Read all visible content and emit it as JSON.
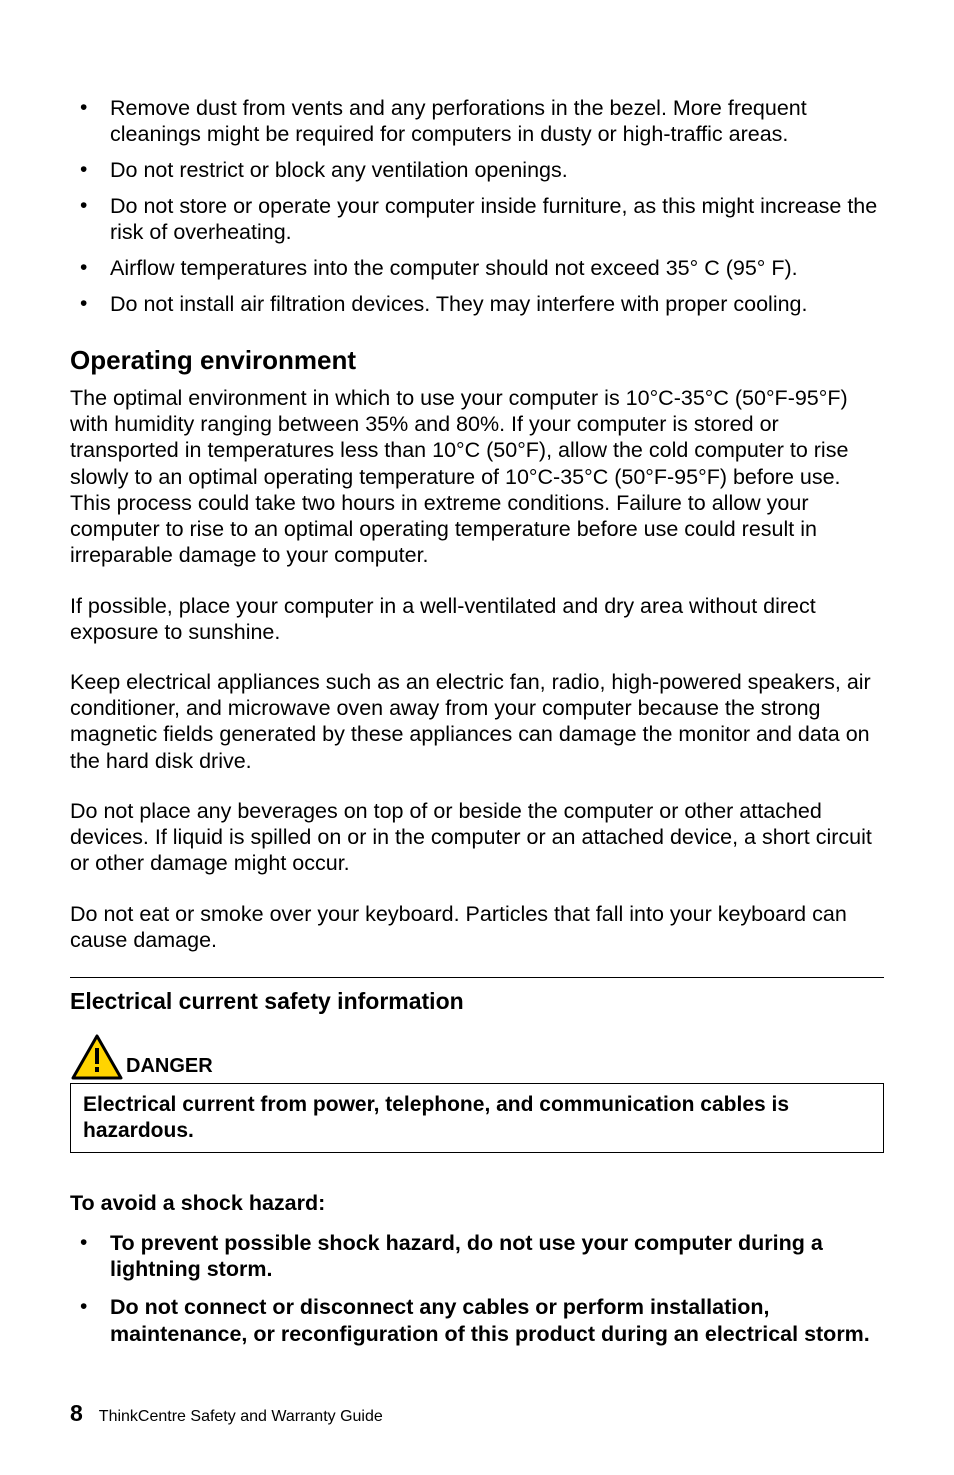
{
  "top_bullets": [
    "Remove dust from vents and any perforations in the bezel. More frequent cleanings might be required for computers in dusty or high-traffic areas.",
    "Do not restrict or block any ventilation openings.",
    "Do not store or operate your computer inside furniture, as this might increase the risk of overheating.",
    "Airflow temperatures into the computer should not exceed 35° C (95° F).",
    "Do not install air filtration devices. They may interfere with proper cooling."
  ],
  "section1": {
    "heading": "Operating environment",
    "paragraphs": [
      "The optimal environment in which to use your computer is 10°C-35°C (50°F-95°F) with humidity ranging between 35% and 80%. If your computer is stored or transported in temperatures less than 10°C (50°F), allow the cold computer to rise slowly to an optimal operating temperature of 10°C-35°C (50°F-95°F) before use. This process could take two hours in extreme conditions. Failure to allow your computer to rise to an optimal operating temperature before use could result in irreparable damage to your computer.",
      "If possible, place your computer in a well-ventilated and dry area without direct exposure to sunshine.",
      "Keep electrical appliances such as an electric fan, radio, high-powered speakers, air conditioner, and microwave oven away from your computer because the strong magnetic fields generated by these appliances can damage the monitor and data on the hard disk drive.",
      "Do not place any beverages on top of or beside the computer or other attached devices. If liquid is spilled on or in the computer or an attached device, a short circuit or other damage might occur.",
      "Do not eat or smoke over your keyboard. Particles that fall into your keyboard can cause damage."
    ]
  },
  "section2": {
    "heading": "Electrical current safety information",
    "danger_label": "DANGER",
    "danger_text": "Electrical current from power, telephone, and communication cables is hazardous.",
    "avoid_heading": "To avoid a shock hazard:",
    "avoid_bullets": [
      "To prevent possible shock hazard, do not use your computer during a lightning storm.",
      "Do not connect or disconnect any cables or perform installation, maintenance, or reconfiguration of this product during an electrical storm."
    ]
  },
  "footer": {
    "page_number": "8",
    "text": "ThinkCentre Safety and Warranty Guide"
  }
}
